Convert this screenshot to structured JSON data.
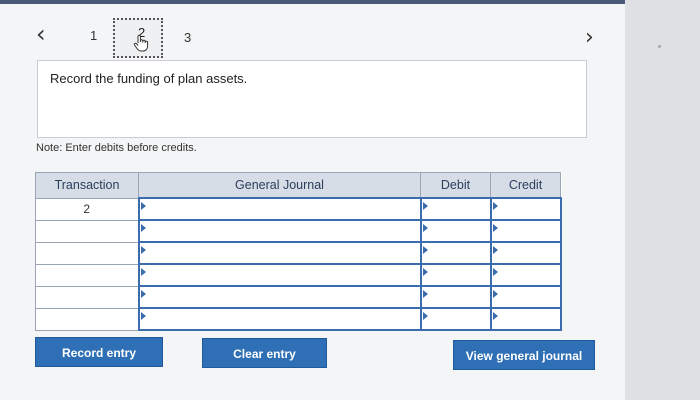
{
  "nav": {
    "steps": [
      "1",
      "2",
      "3"
    ],
    "current_step": "2"
  },
  "instruction": "Record the funding of plan assets.",
  "note": "Note: Enter debits before credits.",
  "table": {
    "headers": [
      "Transaction",
      "General Journal",
      "Debit",
      "Credit"
    ],
    "rows": [
      {
        "transaction": "2",
        "account": "",
        "debit": "",
        "credit": ""
      },
      {
        "transaction": "",
        "account": "",
        "debit": "",
        "credit": ""
      },
      {
        "transaction": "",
        "account": "",
        "debit": "",
        "credit": ""
      },
      {
        "transaction": "",
        "account": "",
        "debit": "",
        "credit": ""
      },
      {
        "transaction": "",
        "account": "",
        "debit": "",
        "credit": ""
      },
      {
        "transaction": "",
        "account": "",
        "debit": "",
        "credit": ""
      }
    ]
  },
  "buttons": {
    "record": "Record entry",
    "clear": "Clear entry",
    "view": "View general journal"
  },
  "colors": {
    "button": "#2e6fb5",
    "header_bg": "#d6dde6",
    "input_border": "#3a6cae"
  }
}
